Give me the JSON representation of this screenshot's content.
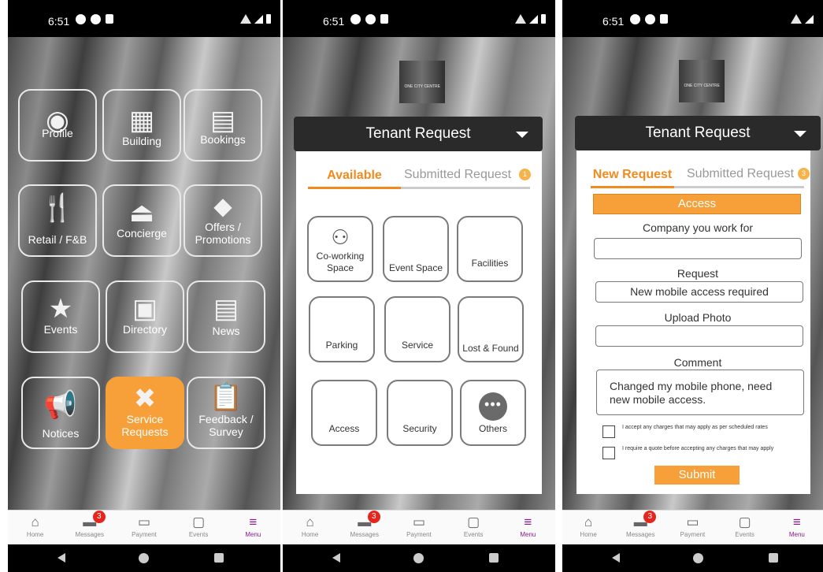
{
  "status": {
    "time": "6:51"
  },
  "tabbar": [
    {
      "label": "Home",
      "icon": "home-icon"
    },
    {
      "label": "Messages",
      "icon": "messages-icon",
      "badge": "3"
    },
    {
      "label": "Payment",
      "icon": "payment-icon"
    },
    {
      "label": "Events",
      "icon": "events-icon"
    },
    {
      "label": "Menu",
      "icon": "menu-icon",
      "active": true
    }
  ],
  "menu": {
    "tiles": [
      {
        "label": "Profile",
        "icon": "profile-icon"
      },
      {
        "label": "Building",
        "icon": "building-icon"
      },
      {
        "label": "Bookings",
        "icon": "bookings-icon"
      },
      {
        "label": "Retail / F&B",
        "icon": "food-drink-icon"
      },
      {
        "label": "Concierge",
        "icon": "concierge-bell-icon"
      },
      {
        "label": "Offers / Promotions",
        "icon": "tag-icon"
      },
      {
        "label": "Events",
        "icon": "calendar-star-icon"
      },
      {
        "label": "Directory",
        "icon": "contact-card-icon"
      },
      {
        "label": "News",
        "icon": "newspaper-icon"
      },
      {
        "label": "Notices",
        "icon": "megaphone-icon"
      },
      {
        "label": "Service Requests",
        "icon": "tools-icon",
        "active": true
      },
      {
        "label": "Feedback / Survey",
        "icon": "clipboard-icon"
      }
    ]
  },
  "request": {
    "logo_text": "ONE CITY CENTRE",
    "dropdown_label": "Tenant Request",
    "tab_available": "Available",
    "tab_new": "New Request",
    "tab_submitted": "Submitted Request",
    "submitted_count_1": "1",
    "submitted_count_2": "3",
    "categories": [
      {
        "label": "Co-working Space",
        "icon": "people-group-icon"
      },
      {
        "label": "Event Space"
      },
      {
        "label": "Facilities"
      },
      {
        "label": "Parking"
      },
      {
        "label": "Service"
      },
      {
        "label": "Lost & Found"
      },
      {
        "label": "Access"
      },
      {
        "label": "Security"
      },
      {
        "label": "Others",
        "icon": "more-dots-icon"
      }
    ]
  },
  "form": {
    "category": "Access",
    "company_label": "Company you work for",
    "company_value": "",
    "request_label": "Request",
    "request_value": "New mobile access required",
    "upload_label": "Upload Photo",
    "upload_value": "",
    "comment_label": "Comment",
    "comment_value": "Changed my mobile phone, need new mobile access.",
    "check1": "I accept any charges that may apply as per scheduled rates",
    "check2": "I require a quote before accepting any charges that may apply",
    "submit": "Submit"
  },
  "colors": {
    "accent": "#f7a03a",
    "menu_active": "#8a1a8a",
    "badge": "#e5261f"
  }
}
